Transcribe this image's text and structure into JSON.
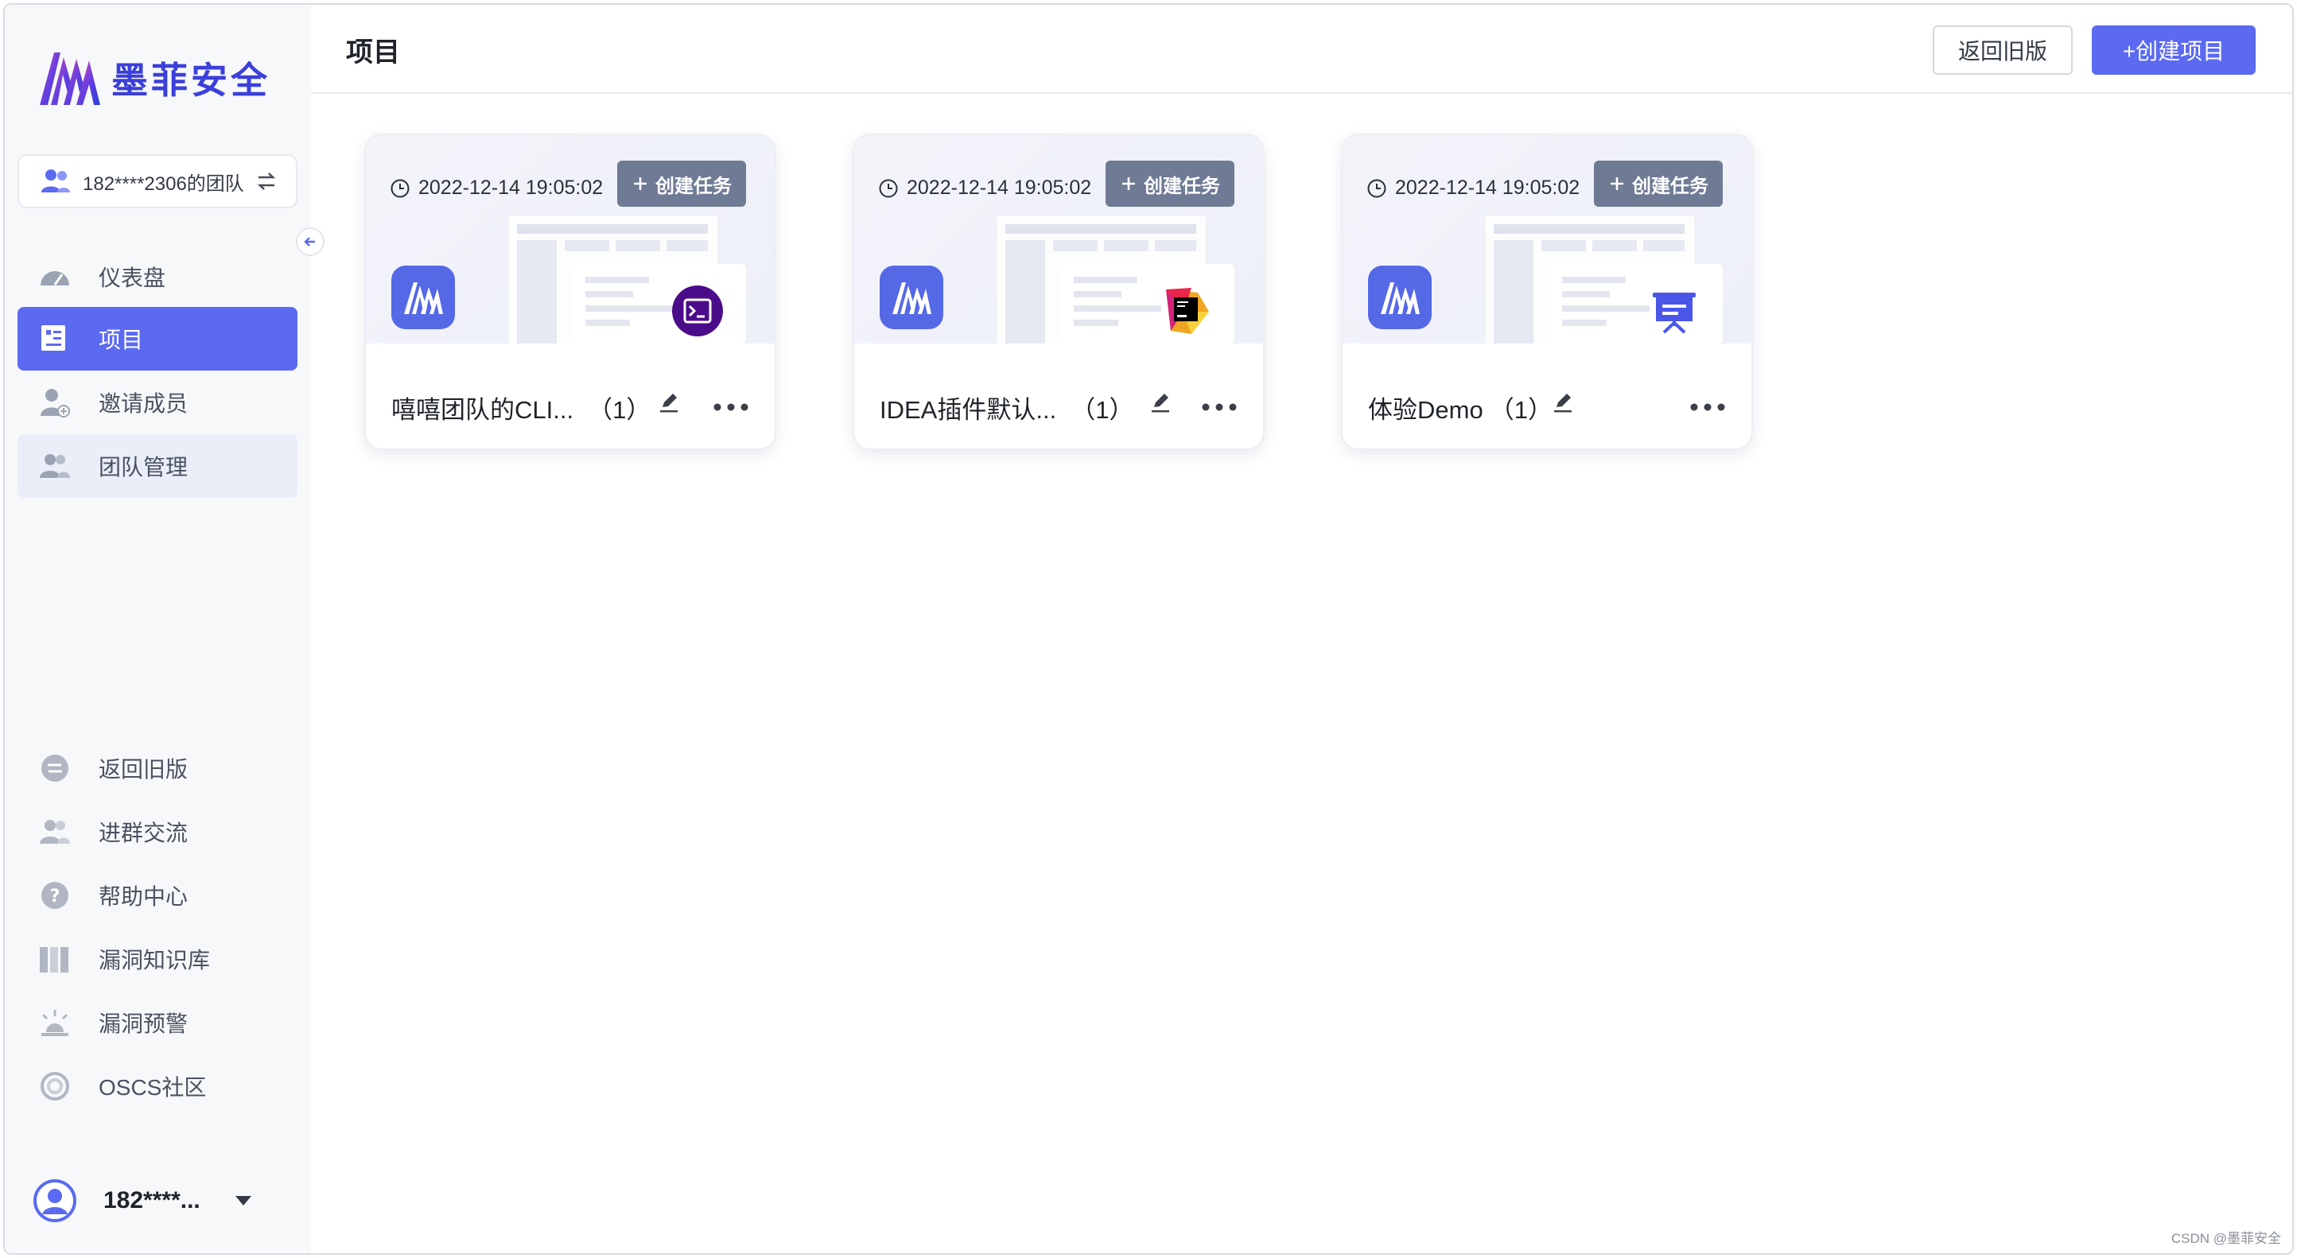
{
  "app": {
    "brand": "墨菲安全",
    "watermark": "CSDN @墨菲安全"
  },
  "sidebar": {
    "team_label": "182****2306的团队",
    "nav": [
      {
        "label": "仪表盘",
        "icon": "dashboard-icon"
      },
      {
        "label": "项目",
        "icon": "project-icon",
        "active": true
      },
      {
        "label": "邀请成员",
        "icon": "invite-member-icon"
      },
      {
        "label": "团队管理",
        "icon": "team-icon"
      }
    ],
    "bottom": [
      {
        "label": "返回旧版",
        "icon": "switch-icon"
      },
      {
        "label": "进群交流",
        "icon": "group-icon"
      },
      {
        "label": "帮助中心",
        "icon": "help-icon"
      },
      {
        "label": "漏洞知识库",
        "icon": "library-icon"
      },
      {
        "label": "漏洞预警",
        "icon": "alarm-icon"
      },
      {
        "label": "OSCS社区",
        "icon": "community-icon"
      }
    ],
    "user_name": "182****..."
  },
  "header": {
    "title": "项目",
    "back_old_label": "返回旧版",
    "create_project_label": "+创建项目"
  },
  "projects": [
    {
      "date": "2022-12-14 19:05:02",
      "name": "嘻嘻团队的CLI...",
      "count": "（1）",
      "create_task_label": "创建任务",
      "tool": "terminal"
    },
    {
      "date": "2022-12-14 19:05:02",
      "name": "IDEA插件默认...",
      "count": "（1）",
      "create_task_label": "创建任务",
      "tool": "jetbrains"
    },
    {
      "date": "2022-12-14 19:05:02",
      "name": "体验Demo",
      "count": "（1）",
      "create_task_label": "创建任务",
      "tool": "demo"
    }
  ],
  "colors": {
    "accent": "#5b6af0",
    "brand_text": "#3b3fd9",
    "task_button": "#6f7a95"
  }
}
